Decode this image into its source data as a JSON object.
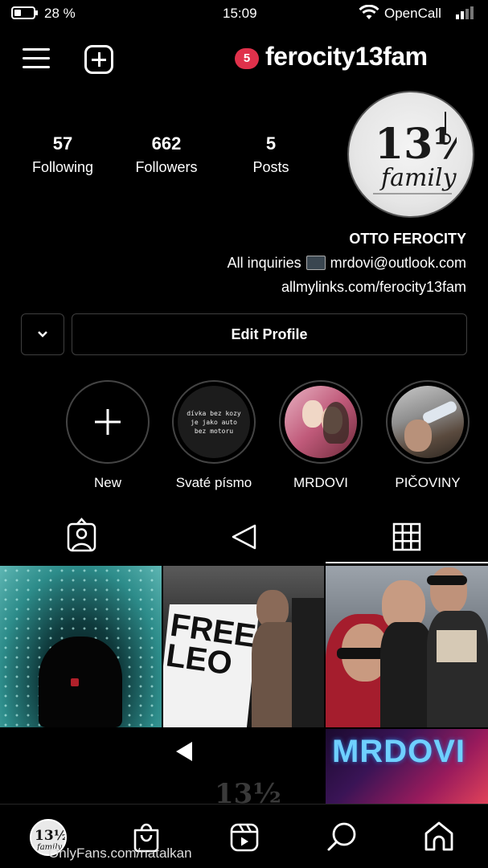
{
  "status_bar": {
    "battery_percent": "28 %",
    "time": "15:09",
    "carrier": "OpenCall"
  },
  "header": {
    "username": "ferocity13fam",
    "notification_count": "5",
    "badge_color": "#e0314b"
  },
  "stats": [
    {
      "value": "5",
      "label": "Posts"
    },
    {
      "value": "662",
      "label": "Followers"
    },
    {
      "value": "57",
      "label": "Following"
    }
  ],
  "bio": {
    "name": "OTTO FEROCITY",
    "line1_prefix": "All inquiries",
    "line1_suffix": "mrdovi@outlook.com",
    "link": "allmylinks.com/ferocity13fam"
  },
  "buttons": {
    "edit_profile": "Edit Profile"
  },
  "highlights": [
    {
      "label": "PIČOVINY"
    },
    {
      "label": "MRDOVI"
    },
    {
      "label": "Svaté písmo",
      "cover_text": "dívka bez kozy je jako auto bez motoru"
    },
    {
      "label": "New"
    }
  ],
  "tabs": [
    {
      "icon": "grid-icon",
      "active": true
    },
    {
      "icon": "reels-play-icon",
      "active": false
    },
    {
      "icon": "tagged-person-icon",
      "active": false
    }
  ],
  "posts": [
    {
      "overlay_text": "FREE LEO"
    },
    {
      "overlay_text": "MRDOVI"
    }
  ],
  "avatar_text": "13½ family",
  "bottom_nav": [
    "home-icon",
    "search-icon",
    "reels-icon",
    "shop-icon",
    "profile-avatar"
  ],
  "watermark": "OnlyFans.com/natalkan"
}
